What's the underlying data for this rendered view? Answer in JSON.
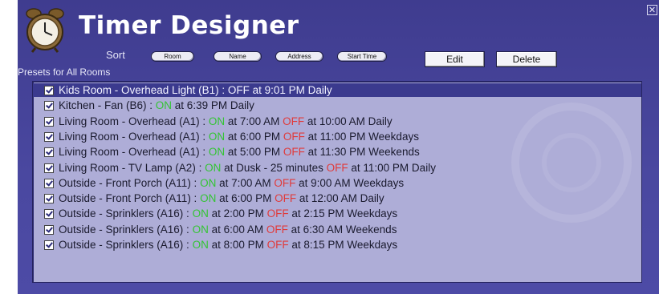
{
  "window": {
    "title": "Timer Designer",
    "close_glyph": "✕"
  },
  "icons": {
    "app": "alarm-clock-icon",
    "close": "close-icon"
  },
  "colors": {
    "window_bg": "#4a48a0",
    "list_bg": "#aeadd7",
    "selected_bg": "#3b3a8e",
    "on_color": "#34c434",
    "off_color": "#e03a3a"
  },
  "toolbar": {
    "sort_label": "Sort",
    "sort_buttons": [
      "Room",
      "Name",
      "Address",
      "Start Time"
    ],
    "edit_label": "Edit",
    "delete_label": "Delete"
  },
  "presets": {
    "label": "Presets for All Rooms",
    "selected_index": 0,
    "items": [
      {
        "checked": true,
        "prefix": "Kids Room - Overhead Light (B1) : ",
        "on": "",
        "mid": "",
        "off": "OFF",
        "suffix": " at 9:01 PM Daily"
      },
      {
        "checked": true,
        "prefix": "Kitchen - Fan (B6) : ",
        "on": "ON",
        "mid": " at 6:39 PM Daily",
        "off": "",
        "suffix": ""
      },
      {
        "checked": true,
        "prefix": "Living Room - Overhead (A1) : ",
        "on": "ON",
        "mid": " at 7:00 AM ",
        "off": "OFF",
        "suffix": " at 10:00 AM Daily"
      },
      {
        "checked": true,
        "prefix": "Living Room - Overhead (A1) : ",
        "on": "ON",
        "mid": " at 6:00 PM ",
        "off": "OFF",
        "suffix": " at 11:00 PM Weekdays"
      },
      {
        "checked": true,
        "prefix": "Living Room - Overhead (A1) : ",
        "on": "ON",
        "mid": " at 5:00 PM ",
        "off": "OFF",
        "suffix": " at 11:30 PM Weekends"
      },
      {
        "checked": true,
        "prefix": "Living Room - TV Lamp (A2) : ",
        "on": "ON",
        "mid": " at Dusk - 25 minutes ",
        "off": "OFF",
        "suffix": " at 11:00 PM Daily"
      },
      {
        "checked": true,
        "prefix": "Outside - Front Porch (A11) : ",
        "on": "ON",
        "mid": " at 7:00 AM ",
        "off": "OFF",
        "suffix": " at 9:00 AM Weekdays"
      },
      {
        "checked": true,
        "prefix": "Outside - Front Porch (A11) : ",
        "on": "ON",
        "mid": " at 6:00 PM ",
        "off": "OFF",
        "suffix": " at 12:00 AM Daily"
      },
      {
        "checked": true,
        "prefix": "Outside - Sprinklers (A16) : ",
        "on": "ON",
        "mid": " at 2:00 PM ",
        "off": "OFF",
        "suffix": " at 2:15 PM Weekdays"
      },
      {
        "checked": true,
        "prefix": "Outside - Sprinklers (A16) : ",
        "on": "ON",
        "mid": " at 6:00 AM ",
        "off": "OFF",
        "suffix": " at 6:30 AM Weekends"
      },
      {
        "checked": true,
        "prefix": "Outside - Sprinklers (A16) : ",
        "on": "ON",
        "mid": " at 8:00 PM ",
        "off": "OFF",
        "suffix": " at 8:15 PM Weekdays"
      }
    ]
  }
}
